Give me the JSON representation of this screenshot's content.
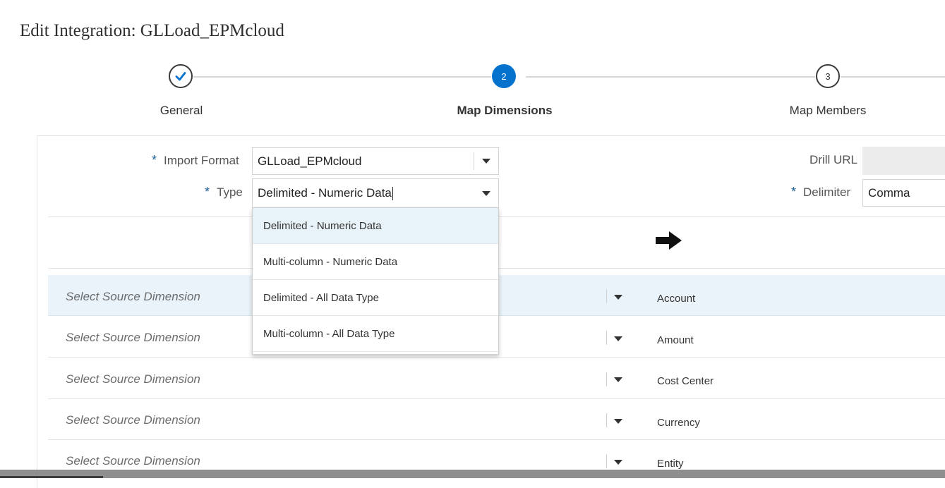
{
  "page": {
    "title": "Edit Integration: GLLoad_EPMcloud"
  },
  "train": {
    "steps": [
      {
        "number": "",
        "label": "General",
        "state": "done"
      },
      {
        "number": "2",
        "label": "Map Dimensions",
        "state": "active"
      },
      {
        "number": "3",
        "label": "Map Members",
        "state": "upcoming"
      }
    ]
  },
  "form": {
    "required_marker": "*",
    "import_format": {
      "label": "Import Format",
      "value": "GLLoad_EPMcloud"
    },
    "type": {
      "label": "Type",
      "value": "Delimited - Numeric Data"
    },
    "drill_url": {
      "label": "Drill URL",
      "value": ""
    },
    "delimiter": {
      "label": "Delimiter",
      "value": "Comma"
    }
  },
  "type_dropdown": {
    "options": [
      "Delimited - Numeric Data",
      "Multi-column - Numeric Data",
      "Delimited - All Data Type",
      "Multi-column - All Data Type"
    ],
    "highlighted_index": 0
  },
  "mapping": {
    "placeholder": "Select Source Dimension",
    "rows": [
      {
        "source": "Select Source Dimension",
        "target": "Account"
      },
      {
        "source": "Select Source Dimension",
        "target": "Amount"
      },
      {
        "source": "Select Source Dimension",
        "target": "Cost Center"
      },
      {
        "source": "Select Source Dimension",
        "target": "Currency"
      },
      {
        "source": "Select Source Dimension",
        "target": "Entity"
      }
    ],
    "selected_row": 0
  },
  "icons": {
    "step_done": "checkmark-icon",
    "mapping_arrow": "arrow-right-icon",
    "dropdown": "caret-down-icon"
  },
  "colors": {
    "accent": "#0572ce",
    "required": "#1d5f99",
    "selected_row": "#eaf3fa"
  }
}
